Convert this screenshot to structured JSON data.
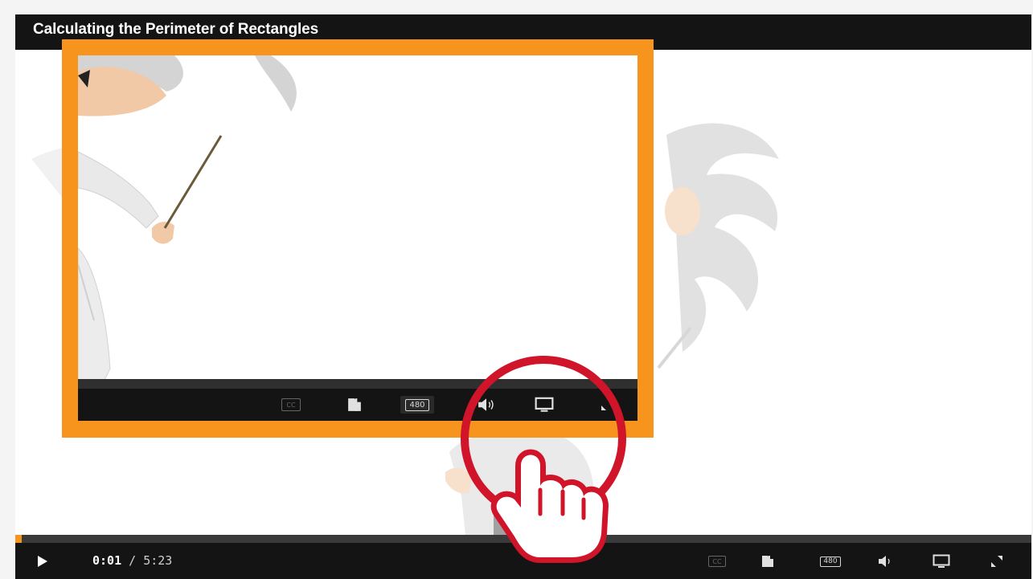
{
  "video": {
    "title": "Calculating the Perimeter of Rectangles"
  },
  "player": {
    "current_time": "0:01",
    "separator": " / ",
    "duration": "5:23",
    "progress": 0.003,
    "quality_label": "480",
    "cc_label": "CC"
  },
  "inset": {
    "quality_label": "480",
    "cc_label": "CC"
  },
  "colors": {
    "accent_orange": "#f7941d",
    "highlight_red": "#d0142a",
    "bar_black": "#141414"
  },
  "icons": {
    "play": "play-icon",
    "captions": "closed-captions-icon",
    "transcript": "transcript-icon",
    "quality": "quality-icon",
    "volume": "volume-icon",
    "screen": "screen-icon",
    "fullscreen": "fullscreen-icon",
    "pointer": "hand-pointer-icon",
    "highlight": "highlight-circle"
  }
}
